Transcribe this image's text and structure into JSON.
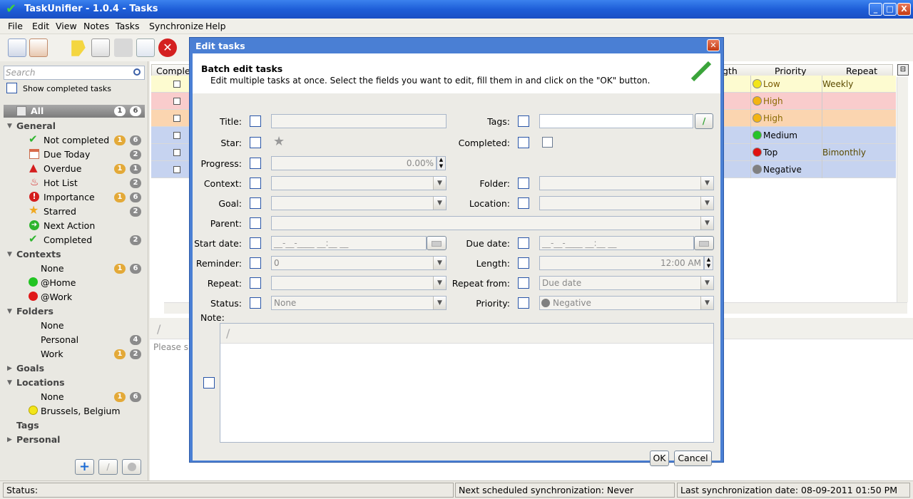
{
  "window": {
    "title": "TaskUnifier - 1.0.4 - Tasks",
    "min": "_",
    "max": "□",
    "close": "X"
  },
  "menu": [
    "File",
    "Edit",
    "View",
    "Notes",
    "Tasks",
    "Synchronize",
    "Help"
  ],
  "sidebar": {
    "search_placeholder": "Search",
    "show_completed": "Show completed tasks",
    "all": {
      "label": "All",
      "b1": "1",
      "b2": "6"
    },
    "general": {
      "label": "General",
      "items": [
        {
          "label": "Not completed",
          "b1": "1",
          "b2": "6"
        },
        {
          "label": "Due Today",
          "b2": "2"
        },
        {
          "label": "Overdue",
          "b1": "1",
          "b2": "1"
        },
        {
          "label": "Hot List",
          "b2": "2"
        },
        {
          "label": "Importance",
          "b1": "1",
          "b2": "6"
        },
        {
          "label": "Starred",
          "b2": "2"
        },
        {
          "label": "Next Action"
        },
        {
          "label": "Completed",
          "b2": "2"
        }
      ]
    },
    "contexts": {
      "label": "Contexts",
      "items": [
        {
          "label": "None",
          "b1": "1",
          "b2": "6"
        },
        {
          "label": "@Home"
        },
        {
          "label": "@Work"
        }
      ]
    },
    "folders": {
      "label": "Folders",
      "items": [
        {
          "label": "None"
        },
        {
          "label": "Personal",
          "b2": "4"
        },
        {
          "label": "Work",
          "b1": "1",
          "b2": "2"
        }
      ]
    },
    "goals": "Goals",
    "locations": {
      "label": "Locations",
      "items": [
        {
          "label": "None",
          "b1": "1",
          "b2": "6"
        },
        {
          "label": "Brussels, Belgium"
        }
      ]
    },
    "tags": "Tags",
    "personal": "Personal"
  },
  "grid": {
    "headers": {
      "completed": "Complet",
      "length": "gth",
      "priority": "Priority",
      "repeat": "Repeat"
    },
    "rows": [
      {
        "priority": "Low",
        "repeat": "Weekly",
        "bg": "#fdfbd0",
        "dot": "#f2e51a",
        "pcolor": "#7a5a00"
      },
      {
        "priority": "High",
        "repeat": "",
        "bg": "#f9cccc",
        "dot": "#f3b413",
        "pcolor": "#8a6a00"
      },
      {
        "priority": "High",
        "repeat": "",
        "bg": "#fbd5b0",
        "dot": "#f3b413",
        "pcolor": "#8a6a00"
      },
      {
        "priority": "Medium",
        "repeat": "",
        "bg": "#c6d3f0",
        "dot": "#27c427",
        "pcolor": "#000"
      },
      {
        "priority": "Top",
        "repeat": "Bimonthly",
        "bg": "#c6d3f0",
        "dot": "#e01010",
        "pcolor": "#000"
      },
      {
        "priority": "Negative",
        "repeat": "",
        "bg": "#c6d3f0",
        "dot": "#808080",
        "pcolor": "#000"
      }
    ],
    "note_hint": "Please s"
  },
  "status": {
    "status": "Status:",
    "next_sync": "Next scheduled synchronization: Never",
    "last_sync": "Last synchronization date: 08-09-2011 01:50 PM"
  },
  "dialog": {
    "title": "Edit tasks",
    "heading": "Batch edit tasks",
    "description": "Edit multiple tasks at once. Select the fields you want to edit, fill them in and click on the \"OK\" button.",
    "labels": {
      "title": "Title:",
      "tags": "Tags:",
      "star": "Star:",
      "completed": "Completed:",
      "progress": "Progress:",
      "context": "Context:",
      "folder": "Folder:",
      "goal": "Goal:",
      "location": "Location:",
      "parent": "Parent:",
      "start_date": "Start date:",
      "due_date": "Due date:",
      "reminder": "Reminder:",
      "length": "Length:",
      "repeat": "Repeat:",
      "repeat_from": "Repeat from:",
      "status": "Status:",
      "priority": "Priority:",
      "note": "Note:"
    },
    "values": {
      "progress": "0.00%",
      "start_date": "__-__-____ __:__ __",
      "due_date": "__-__-____ __:__ __",
      "reminder": "0",
      "length": "12:00 AM",
      "repeat_from": "Due date",
      "status": "None",
      "priority": "Negative"
    },
    "ok": "OK",
    "cancel": "Cancel"
  }
}
